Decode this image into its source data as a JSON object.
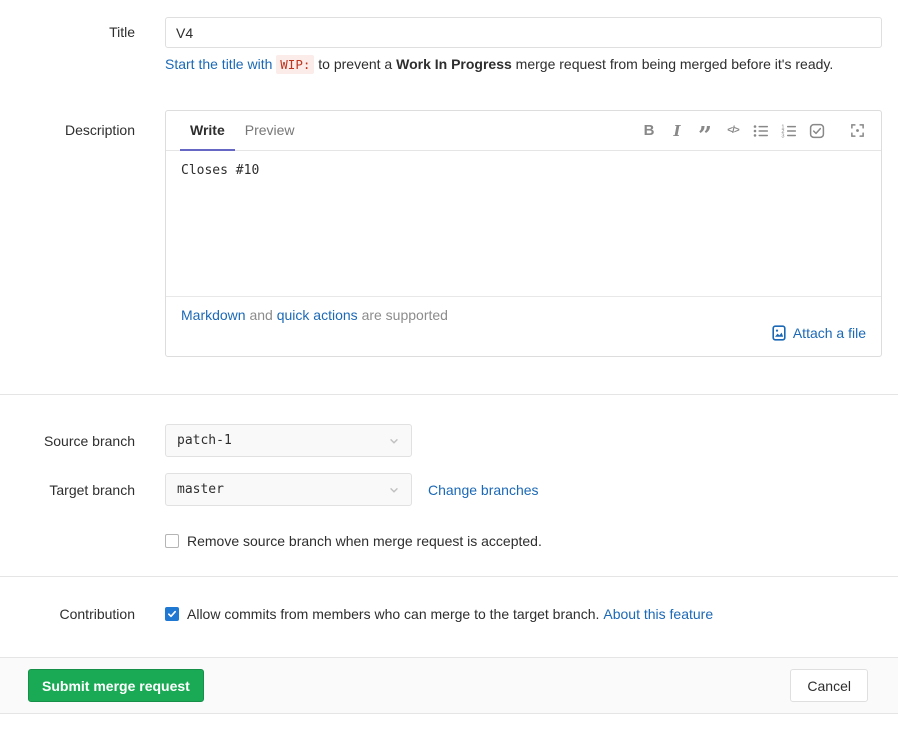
{
  "colors": {
    "link": "#1b69b6",
    "primary_button_bg": "#1aaa55",
    "active_tab_underline": "#6666c4",
    "checkbox_checked": "#1f78d1",
    "wip_code_text": "#c0341d",
    "wip_code_bg": "#fbece9"
  },
  "title_section": {
    "label": "Title",
    "value": "V4",
    "hint": {
      "link_text": "Start the title with",
      "code": "WIP:",
      "middle_text": "to prevent a",
      "bold_text": "Work In Progress",
      "end_text": "merge request from being merged before it's ready."
    }
  },
  "description_section": {
    "label": "Description",
    "tabs": [
      {
        "label": "Write"
      },
      {
        "label": "Preview"
      }
    ],
    "toolbar": {
      "bold_glyph": "B",
      "italic_glyph": "I",
      "quote_glyph": "”",
      "code_glyph": "</>"
    },
    "value": "Closes #10",
    "footer": {
      "markdown_link": "Markdown",
      "and_text": "and",
      "quick_actions_link": "quick actions",
      "supported_text": "are supported",
      "attach_link": "Attach a file"
    }
  },
  "branches_section": {
    "source_label": "Source branch",
    "source_value": "patch-1",
    "target_label": "Target branch",
    "target_value": "master",
    "change_branches_link": "Change branches",
    "remove_source_label": "Remove source branch when merge request is accepted."
  },
  "contribution_section": {
    "label": "Contribution",
    "allow_text": "Allow commits from members who can merge to the target branch.",
    "about_link": "About this feature"
  },
  "actions": {
    "submit_label": "Submit merge request",
    "cancel_label": "Cancel"
  }
}
